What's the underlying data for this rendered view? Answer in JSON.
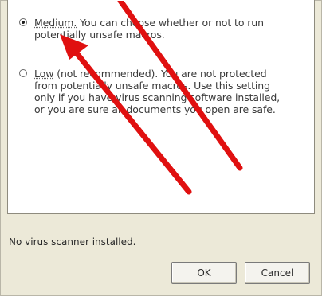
{
  "options": [
    {
      "selected": true,
      "lead": "Medium.",
      "text": "You can choose whether or not to run potentially unsafe macros."
    },
    {
      "selected": false,
      "lead": "Low",
      "text": "(not recommended). You are not protected from potentially unsafe macros. Use this setting only if you have virus scanning software installed, or you are sure all documents you open are safe."
    }
  ],
  "status_text": "No virus scanner installed.",
  "buttons": {
    "ok_label": "OK",
    "cancel_label": "Cancel"
  },
  "annotation": {
    "arrow_color": "#e01010"
  }
}
